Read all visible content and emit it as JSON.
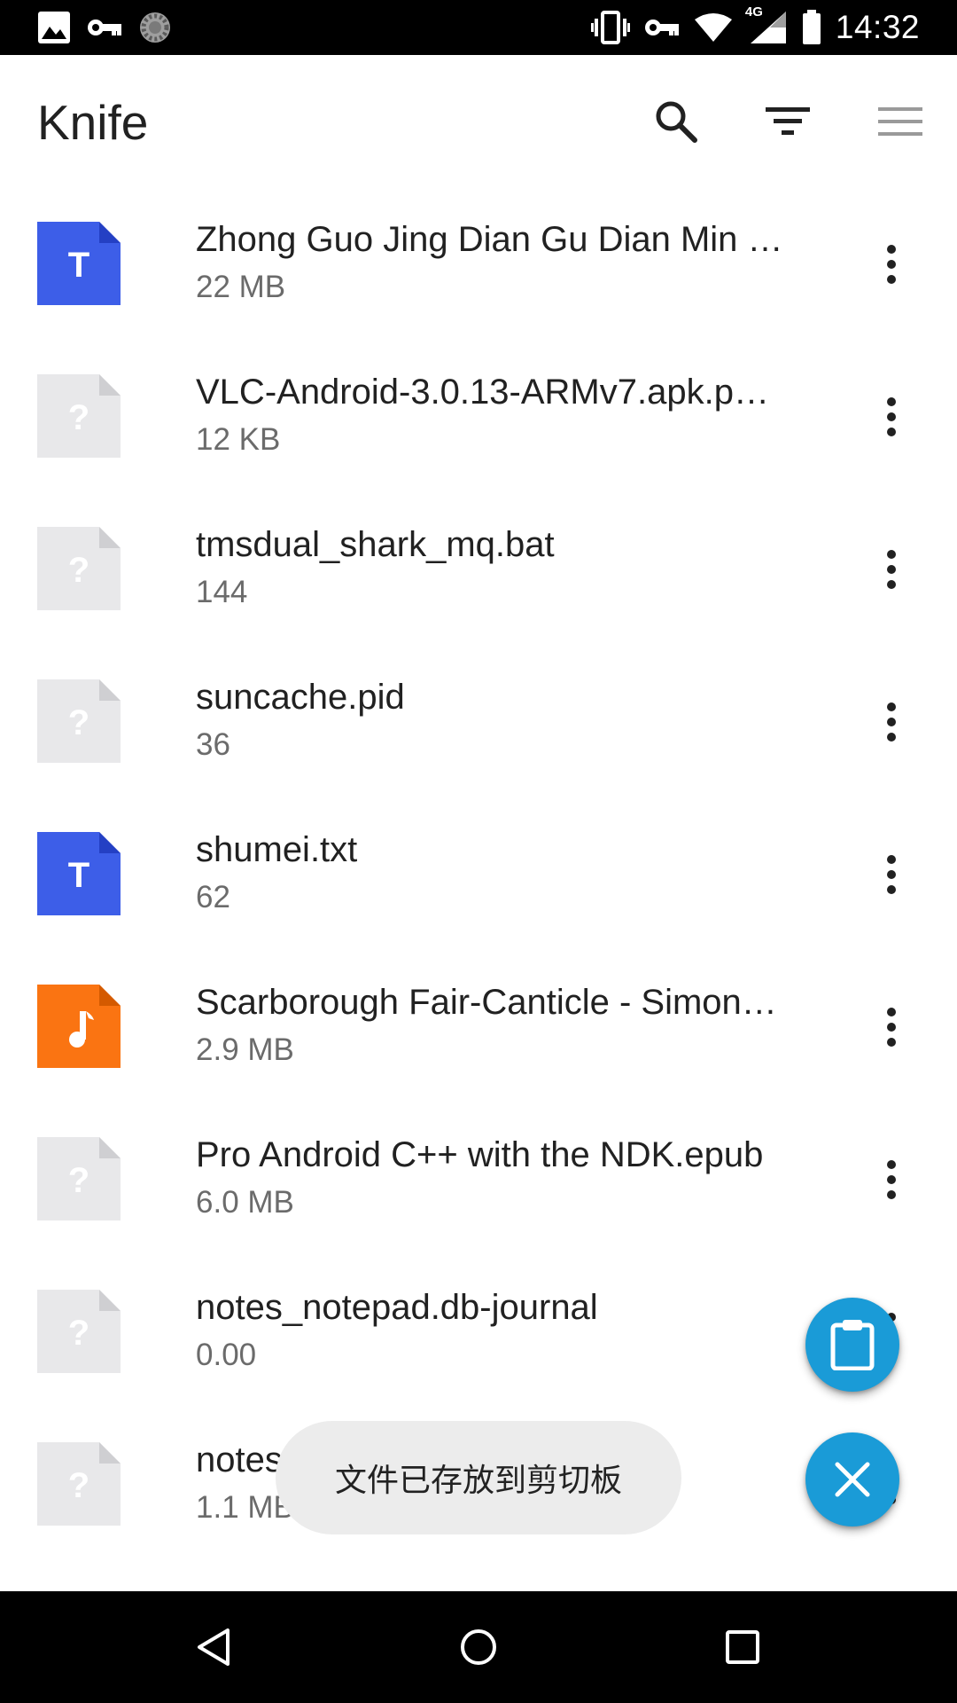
{
  "status_bar": {
    "time": "14:32",
    "network_label": "4G",
    "left_icons": [
      "image-icon",
      "key-icon",
      "sync-icon"
    ],
    "right_icons": [
      "vibrate-icon",
      "vpn-key-icon",
      "wifi-icon",
      "signal-icon",
      "battery-icon"
    ]
  },
  "app_bar": {
    "title": "Knife",
    "actions": [
      "search-icon",
      "filter-icon",
      "menu-icon"
    ]
  },
  "files": [
    {
      "name": "Zhong Guo Jing Dian Gu Dian Min …",
      "size": "22 MB",
      "icon": "text-file-icon"
    },
    {
      "name": "VLC-Android-3.0.13-ARMv7.apk.p…",
      "size": "12 KB",
      "icon": "unknown-file-icon"
    },
    {
      "name": "tmsdual_shark_mq.bat",
      "size": "144",
      "icon": "unknown-file-icon"
    },
    {
      "name": "suncache.pid",
      "size": "36",
      "icon": "unknown-file-icon"
    },
    {
      "name": "shumei.txt",
      "size": "62",
      "icon": "text-file-icon"
    },
    {
      "name": "Scarborough Fair-Canticle - Simon…",
      "size": "2.9 MB",
      "icon": "music-file-icon"
    },
    {
      "name": "Pro Android C++ with the NDK.epub",
      "size": "6.0 MB",
      "icon": "unknown-file-icon"
    },
    {
      "name": "notes_notepad.db-journal",
      "size": "0.00",
      "icon": "unknown-file-icon"
    },
    {
      "name": "notes_notepad.db",
      "size": "1.1 MB",
      "icon": "unknown-file-icon"
    }
  ],
  "toast": {
    "message": "文件已存放到剪切板"
  },
  "fabs": {
    "paste": "clipboard-icon",
    "cancel": "close-icon"
  },
  "colors": {
    "text_file": "#3d5ee8",
    "music_file": "#fa7412",
    "unknown_file": "#e8e8ea",
    "fab": "#1a9bd7",
    "title_text": "#212121",
    "secondary_text": "#6b6b6b"
  }
}
